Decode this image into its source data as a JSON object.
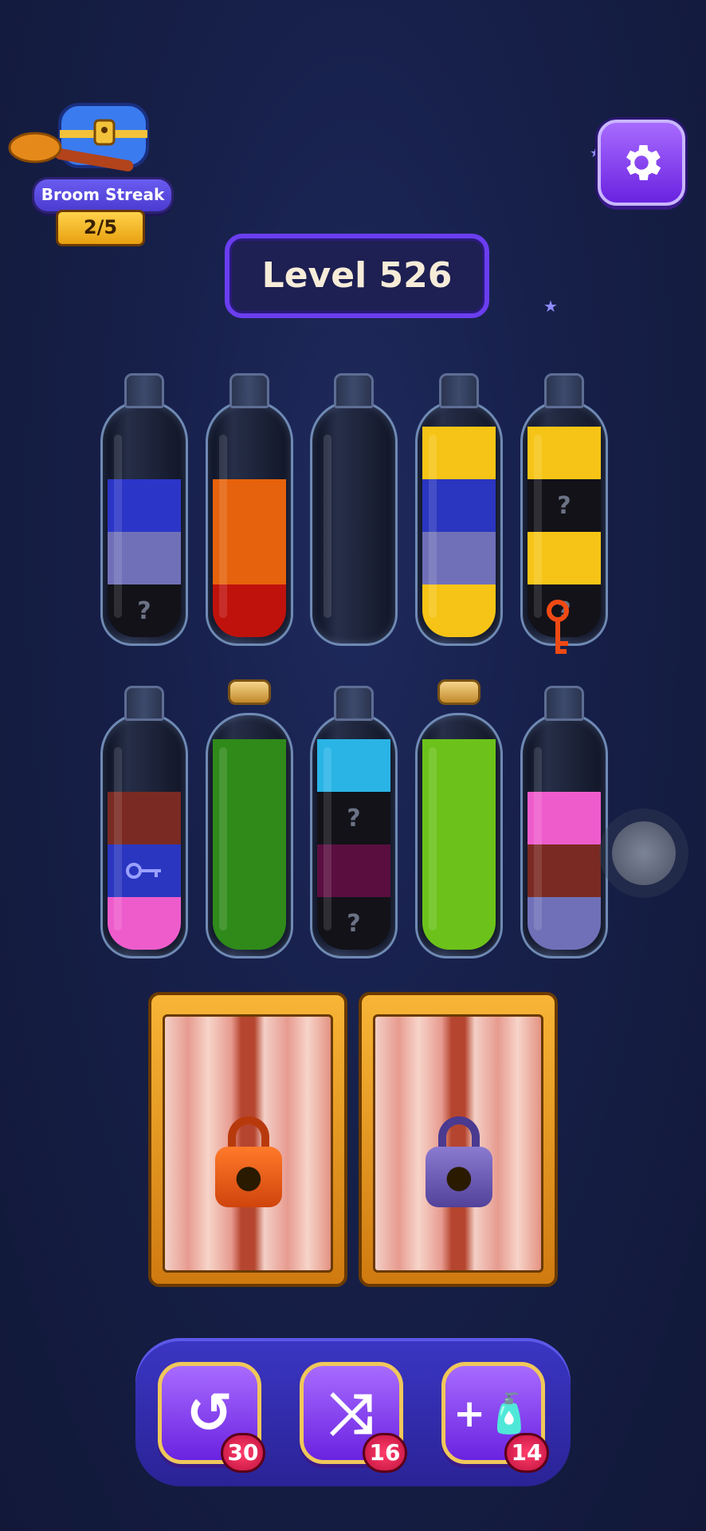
{
  "streak": {
    "title": "Broom Streak",
    "count": "2/5"
  },
  "level": {
    "label": "Level 526"
  },
  "colors": {
    "blue": "#2b35c8",
    "periwinkle": "#6f70b8",
    "black": "#121218",
    "orange": "#e6620c",
    "red": "#c0120c",
    "yellow": "#f6c416",
    "darkblue": "#2a36c0",
    "brown": "#7a2a22",
    "darkpink": "#5a0e40",
    "pink": "#ee5ccc",
    "green": "#2f8a1a",
    "cyan": "#2ab4e6",
    "lime": "#6cc21a"
  },
  "bottles_row1": [
    {
      "layers": [
        {
          "color": "black",
          "label": "?"
        },
        {
          "color": "periwinkle"
        },
        {
          "color": "blue"
        }
      ],
      "corked": false
    },
    {
      "layers": [
        {
          "color": "red"
        },
        {
          "color": "orange"
        },
        {
          "color": "orange"
        }
      ],
      "corked": false
    },
    {
      "layers": [],
      "corked": false
    },
    {
      "layers": [
        {
          "color": "yellow"
        },
        {
          "color": "periwinkle"
        },
        {
          "color": "darkblue"
        },
        {
          "color": "yellow"
        }
      ],
      "corked": false
    },
    {
      "layers": [
        {
          "color": "black",
          "label": "?"
        },
        {
          "color": "yellow"
        },
        {
          "color": "black",
          "label": "?"
        },
        {
          "color": "yellow"
        }
      ],
      "corked": false
    }
  ],
  "bottles_row2": [
    {
      "layers": [
        {
          "color": "pink"
        },
        {
          "color": "darkblue",
          "label": "key"
        },
        {
          "color": "brown"
        }
      ],
      "corked": false
    },
    {
      "layers": [
        {
          "color": "green"
        },
        {
          "color": "green"
        },
        {
          "color": "green"
        },
        {
          "color": "green"
        }
      ],
      "corked": true
    },
    {
      "layers": [
        {
          "color": "black",
          "label": "?"
        },
        {
          "color": "darkpink"
        },
        {
          "color": "black",
          "label": "?"
        },
        {
          "color": "cyan"
        }
      ],
      "corked": false
    },
    {
      "layers": [
        {
          "color": "lime"
        },
        {
          "color": "lime"
        },
        {
          "color": "lime"
        },
        {
          "color": "lime"
        }
      ],
      "corked": true
    },
    {
      "layers": [
        {
          "color": "periwinkle"
        },
        {
          "color": "brown"
        },
        {
          "color": "pink"
        }
      ],
      "corked": false
    }
  ],
  "locks": [
    {
      "color": "#e85a18",
      "name": "orange"
    },
    {
      "color": "#6a5ab0",
      "name": "purple"
    }
  ],
  "tools": [
    {
      "name": "undo",
      "icon": "↺",
      "count": "30"
    },
    {
      "name": "shuffle",
      "icon": "⤨",
      "count": "16"
    },
    {
      "name": "add-bottle",
      "icon": "+🧴",
      "count": "14"
    }
  ]
}
